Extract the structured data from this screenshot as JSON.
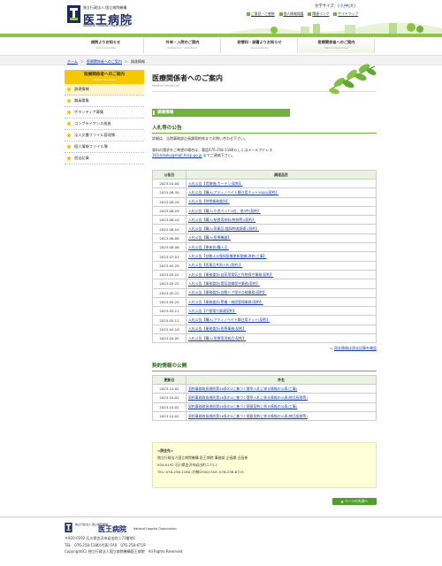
{
  "header": {
    "org_small": "独立行政法人 国立病院機構",
    "hospital_name": "医王病院",
    "hospital_name_en": "National Hospital Organization",
    "text_size_label": "文字サイズ：",
    "text_sizes": [
      "小",
      "中",
      "大"
    ],
    "links": [
      "ご意見・ご感想",
      "個人情報保護",
      "関連リンク",
      "サイトマップ"
    ]
  },
  "nav": {
    "items": [
      {
        "label": "病院よりお知らせ",
        "en": "About Hospital"
      },
      {
        "label": "外来・入院のご案内",
        "en": "Outpatient・Admission"
      },
      {
        "label": "診療科・部署よりお知らせ",
        "en": "Departments"
      },
      {
        "label": "医療関係者へのご案内",
        "en": "Medical Personnel"
      }
    ]
  },
  "breadcrumb": {
    "home": "ホーム",
    "parent": "医療関係者へのご案内",
    "current": "調達情報",
    "separator": "＞"
  },
  "sidebar": {
    "heading": "医療関係者へのご案内",
    "heading_en": "Medical Personnel",
    "items": [
      "調達情報",
      "職員募集",
      "ボランティア募集",
      "コンプライアンス推進",
      "法人文書ファイル管理簿",
      "個人情報ファイル簿",
      "過去記事"
    ]
  },
  "main": {
    "title": "医療関係者へのご案内",
    "title_en": "Medical Personnel",
    "section": "調達情報",
    "bid_heading": "入札等の公告",
    "bid_text1": "詳細は、当院事務部企画課契約係までお問い合わせ下さい。",
    "bid_text2_a": "資料の請求をご希望の場合は、電話076-258-1180もしくはメールアドレス",
    "bid_text2_email": "303-kikaku@mail.hosp.go.jp",
    "bid_text2_b": " までご連絡下さい。",
    "bid_columns": [
      "公告日",
      "調達品目"
    ],
    "bids": [
      {
        "date": "2023.10.04",
        "item": "入札公告【賃貸借(カーテン)契約】"
      },
      {
        "date": "2023.08.30",
        "item": "入札公告【購入(アディノベイト静注用キット3000)契約】"
      },
      {
        "date": "2023.08.29",
        "item": "入札公告【除雪業務委託】"
      },
      {
        "date": "2023.08.29",
        "item": "入札公告【購入(小児ベッド4台、他3件)契約】"
      },
      {
        "date": "2023.08.10",
        "item": "入札公告【購入(給食用材料(乾物等))契約】"
      },
      {
        "date": "2023.08.10",
        "item": "入札公告【購入(医薬品(臨採物流調達))契約】"
      },
      {
        "date": "2023.08.08",
        "item": "入札公告【購入(医療機器】"
      },
      {
        "date": "2023.08.08",
        "item": "入札公告【患者衣(購入)】"
      },
      {
        "date": "2023.07.07",
        "item": "入札公告【自動火災報知設備更新整備(改修)工事】"
      },
      {
        "date": "2023.05.29",
        "item": "入札公告【医薬品共同入札(契約)】"
      },
      {
        "date": "2023.05.22",
        "item": "入札公告【業務委託(自家用電気工作物保守業務)契約】"
      },
      {
        "date": "2023.05.22",
        "item": "入札公告【業務委託(電気設備保守業務)契約】"
      },
      {
        "date": "2023.05.22",
        "item": "入札公告【業務委託(自動ドア保守点検業務)契約】"
      },
      {
        "date": "2023.05.22",
        "item": "入札公告【業務委託(警備・施設管理業務)契約】"
      },
      {
        "date": "2023.05.11",
        "item": "入札公告【介食電力調達契約】"
      },
      {
        "date": "2023.05.11",
        "item": "入札公告【購入(アディノベイト静注用キット)契約】"
      },
      {
        "date": "2023.04.10",
        "item": "入札公告【業務委託(医療事務)契約】"
      },
      {
        "date": "2023.04.05",
        "item": "入札公告【購入(医療用消耗品)契約】"
      }
    ],
    "bid_more": "過去情報は過去記事を確認",
    "contract_heading": "契約情報の公開",
    "contract_columns": [
      "更新日",
      "件名"
    ],
    "contracts": [
      {
        "date": "2023.10.02",
        "item": "契約事務取扱規則第26条の2に基づく競争入札に係る情報の公表(工事)"
      },
      {
        "date": "2023.10.02",
        "item": "契約事務取扱規則第26条の2に基づく競争入札に係る情報の公表(物品役務等)"
      },
      {
        "date": "2023.10.02",
        "item": "契約事務取扱規則第26条の2に基づく随意契約に係る情報の公表(工事)"
      },
      {
        "date": "2023.10.02",
        "item": "契約事務取扱規則第26条の2に基づく随意契約に係る情報の公表(物品役務等)"
      }
    ],
    "contact": {
      "title": "<照会先>",
      "line1": "独立行政法人国立病院機構 医王病院 事務部 企画課 企画係",
      "line2": "920-0192 石川県金沢市岩出町ニ73-1",
      "line3": "TEL: 076-258-1180 (内線2500) FAX: 076-258-6719"
    },
    "pagetop": "ページの先頭へ"
  },
  "footer": {
    "org_small": "独立行政法人 国立病院機構",
    "hospital_name": "医王病院",
    "hospital_name_en": "National Hospital Organization",
    "address": "〒920-0192 石川県金沢市岩出町ニ73番地1",
    "tel": "TEL　076-258-1180(代表) FAX　076-258-6719",
    "copyright": "Copyright(C) 独立行政法人国立病院機構医王病院　All Rights Reserved"
  },
  "colors": {
    "accent_green": "#6fb33a",
    "sidebar_yellow": "#f6c800",
    "link_blue": "#1a3fa8",
    "brand_navy": "#1b2a66"
  }
}
